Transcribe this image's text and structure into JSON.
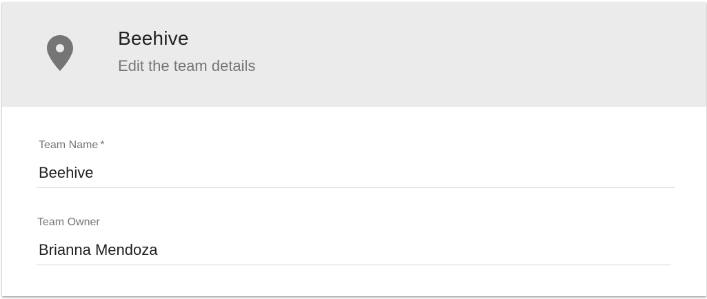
{
  "header": {
    "icon": "map-marker-icon",
    "title": "Beehive",
    "subtitle": "Edit the team details"
  },
  "form": {
    "team_name": {
      "label": "Team Name",
      "required_marker": "*",
      "value": "Beehive"
    },
    "team_owner": {
      "label": "Team Owner",
      "value": "Brianna Mendoza"
    }
  },
  "colors": {
    "header_background": "#ebebeb",
    "icon": "#757575",
    "title_text": "#212121",
    "subtitle_text": "#757575",
    "underline": "#d6d6d6"
  }
}
